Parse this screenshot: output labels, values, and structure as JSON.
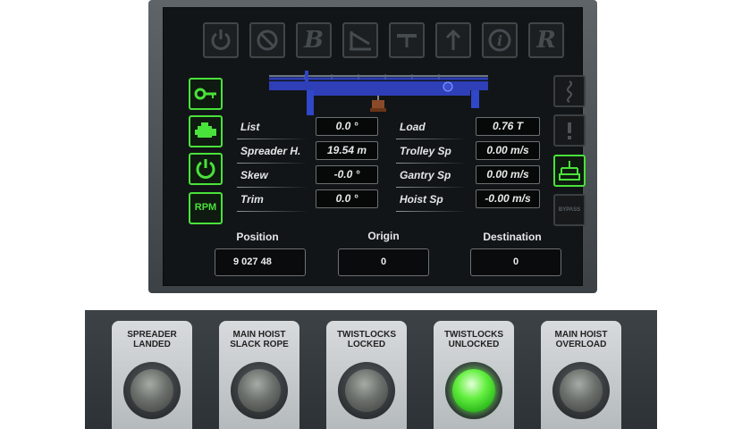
{
  "mode_icons": [
    {
      "name": "power-icon",
      "text": ""
    },
    {
      "name": "prohibit-icon",
      "text": ""
    },
    {
      "name": "b-icon",
      "text": "B"
    },
    {
      "name": "boom-icon",
      "text": ""
    },
    {
      "name": "trolley-icon",
      "text": ""
    },
    {
      "name": "up-arrow-icon",
      "text": ""
    },
    {
      "name": "info-icon",
      "text": "i"
    },
    {
      "name": "r-icon",
      "text": "R"
    }
  ],
  "side_buttons": [
    {
      "name": "key-icon"
    },
    {
      "name": "engine-icon"
    },
    {
      "name": "power-icon"
    },
    {
      "name": "rpm-icon",
      "text": "RPM"
    }
  ],
  "right_icons": [
    {
      "name": "wave-icon",
      "state": "dim"
    },
    {
      "name": "warning-icon",
      "state": "dim"
    },
    {
      "name": "spreader-icon",
      "state": "on"
    },
    {
      "name": "bypass-icon",
      "state": "dim",
      "text": "BYPASS"
    }
  ],
  "left_readouts": [
    {
      "label": "List",
      "value": "0.0 °"
    },
    {
      "label": "Spreader H.",
      "value": "19.54 m"
    },
    {
      "label": "Skew",
      "value": "-0.0 °"
    },
    {
      "label": "Trim",
      "value": "0.0 °"
    }
  ],
  "right_readouts": [
    {
      "label": "Load",
      "value": "0.76 T"
    },
    {
      "label": "Trolley Sp",
      "value": "0.00 m/s"
    },
    {
      "label": "Gantry Sp",
      "value": "0.00 m/s"
    },
    {
      "label": "Hoist Sp",
      "value": "-0.00 m/s"
    }
  ],
  "position": {
    "position_label": "Position",
    "position_value": "9 027 48",
    "origin_label": "Origin",
    "origin_value": "0",
    "destination_label": "Destination",
    "destination_value": "0"
  },
  "indicators": [
    {
      "line1": "SPREADER",
      "line2": "LANDED",
      "state": "off"
    },
    {
      "line1": "MAIN HOIST",
      "line2": "SLACK ROPE",
      "state": "off"
    },
    {
      "line1": "TWISTLOCKS",
      "line2": "LOCKED",
      "state": "off"
    },
    {
      "line1": "TWISTLOCKS",
      "line2": "UNLOCKED",
      "state": "on"
    },
    {
      "line1": "MAIN HOIST",
      "line2": "OVERLOAD",
      "state": "off"
    }
  ],
  "colors": {
    "active_green": "#49e23a",
    "crane_blue": "#2e3fb8",
    "lamp_on": "#63ef3f"
  }
}
